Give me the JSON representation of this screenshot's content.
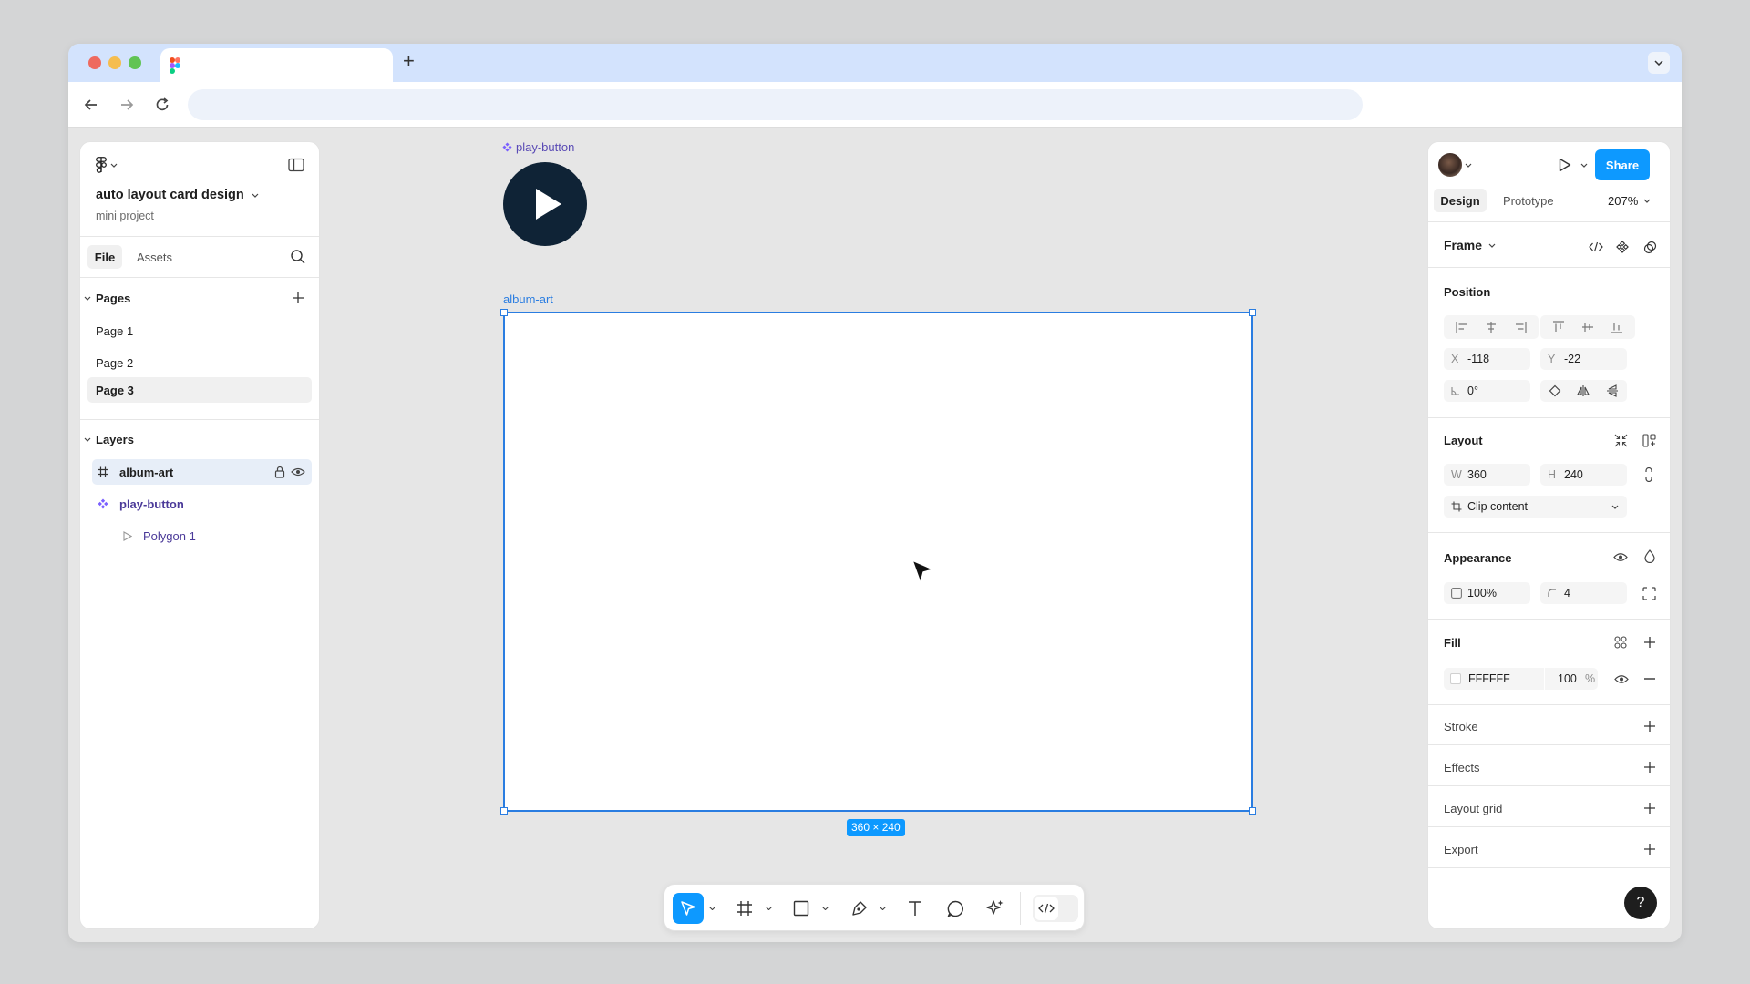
{
  "browser": {
    "new_tab": "+",
    "address": ""
  },
  "file": {
    "title": "auto layout card design",
    "project": "mini project"
  },
  "left_tabs": {
    "file": "File",
    "assets": "Assets"
  },
  "pages": {
    "header": "Pages",
    "items": [
      "Page 1",
      "Page 2",
      "Page 3"
    ],
    "selected": "Page 3"
  },
  "layers": {
    "header": "Layers",
    "items": [
      {
        "name": "album-art",
        "type": "frame"
      },
      {
        "name": "play-button",
        "type": "component"
      },
      {
        "name": "Polygon 1",
        "type": "polygon"
      }
    ]
  },
  "canvas": {
    "component_label": "play-button",
    "frame_label": "album-art",
    "size_badge": "360 × 240"
  },
  "right": {
    "share": "Share",
    "tabs": {
      "design": "Design",
      "prototype": "Prototype"
    },
    "zoom": "207%",
    "selection_type": "Frame",
    "position": {
      "title": "Position",
      "x_label": "X",
      "x": "-118",
      "y_label": "Y",
      "y": "-22",
      "rotation": "0°"
    },
    "layout": {
      "title": "Layout",
      "w_label": "W",
      "w": "360",
      "h_label": "H",
      "h": "240",
      "clip": "Clip content"
    },
    "appearance": {
      "title": "Appearance",
      "opacity": "100%",
      "radius": "4"
    },
    "fill": {
      "title": "Fill",
      "hex": "FFFFFF",
      "opacity": "100",
      "percent": "%"
    },
    "sections": [
      "Stroke",
      "Effects",
      "Layout grid",
      "Export"
    ],
    "help": "?"
  },
  "colors": {
    "accent": "#0d99ff",
    "selection": "#2a7de1",
    "component": "#7b61ff",
    "play_button": "#0f2336"
  }
}
